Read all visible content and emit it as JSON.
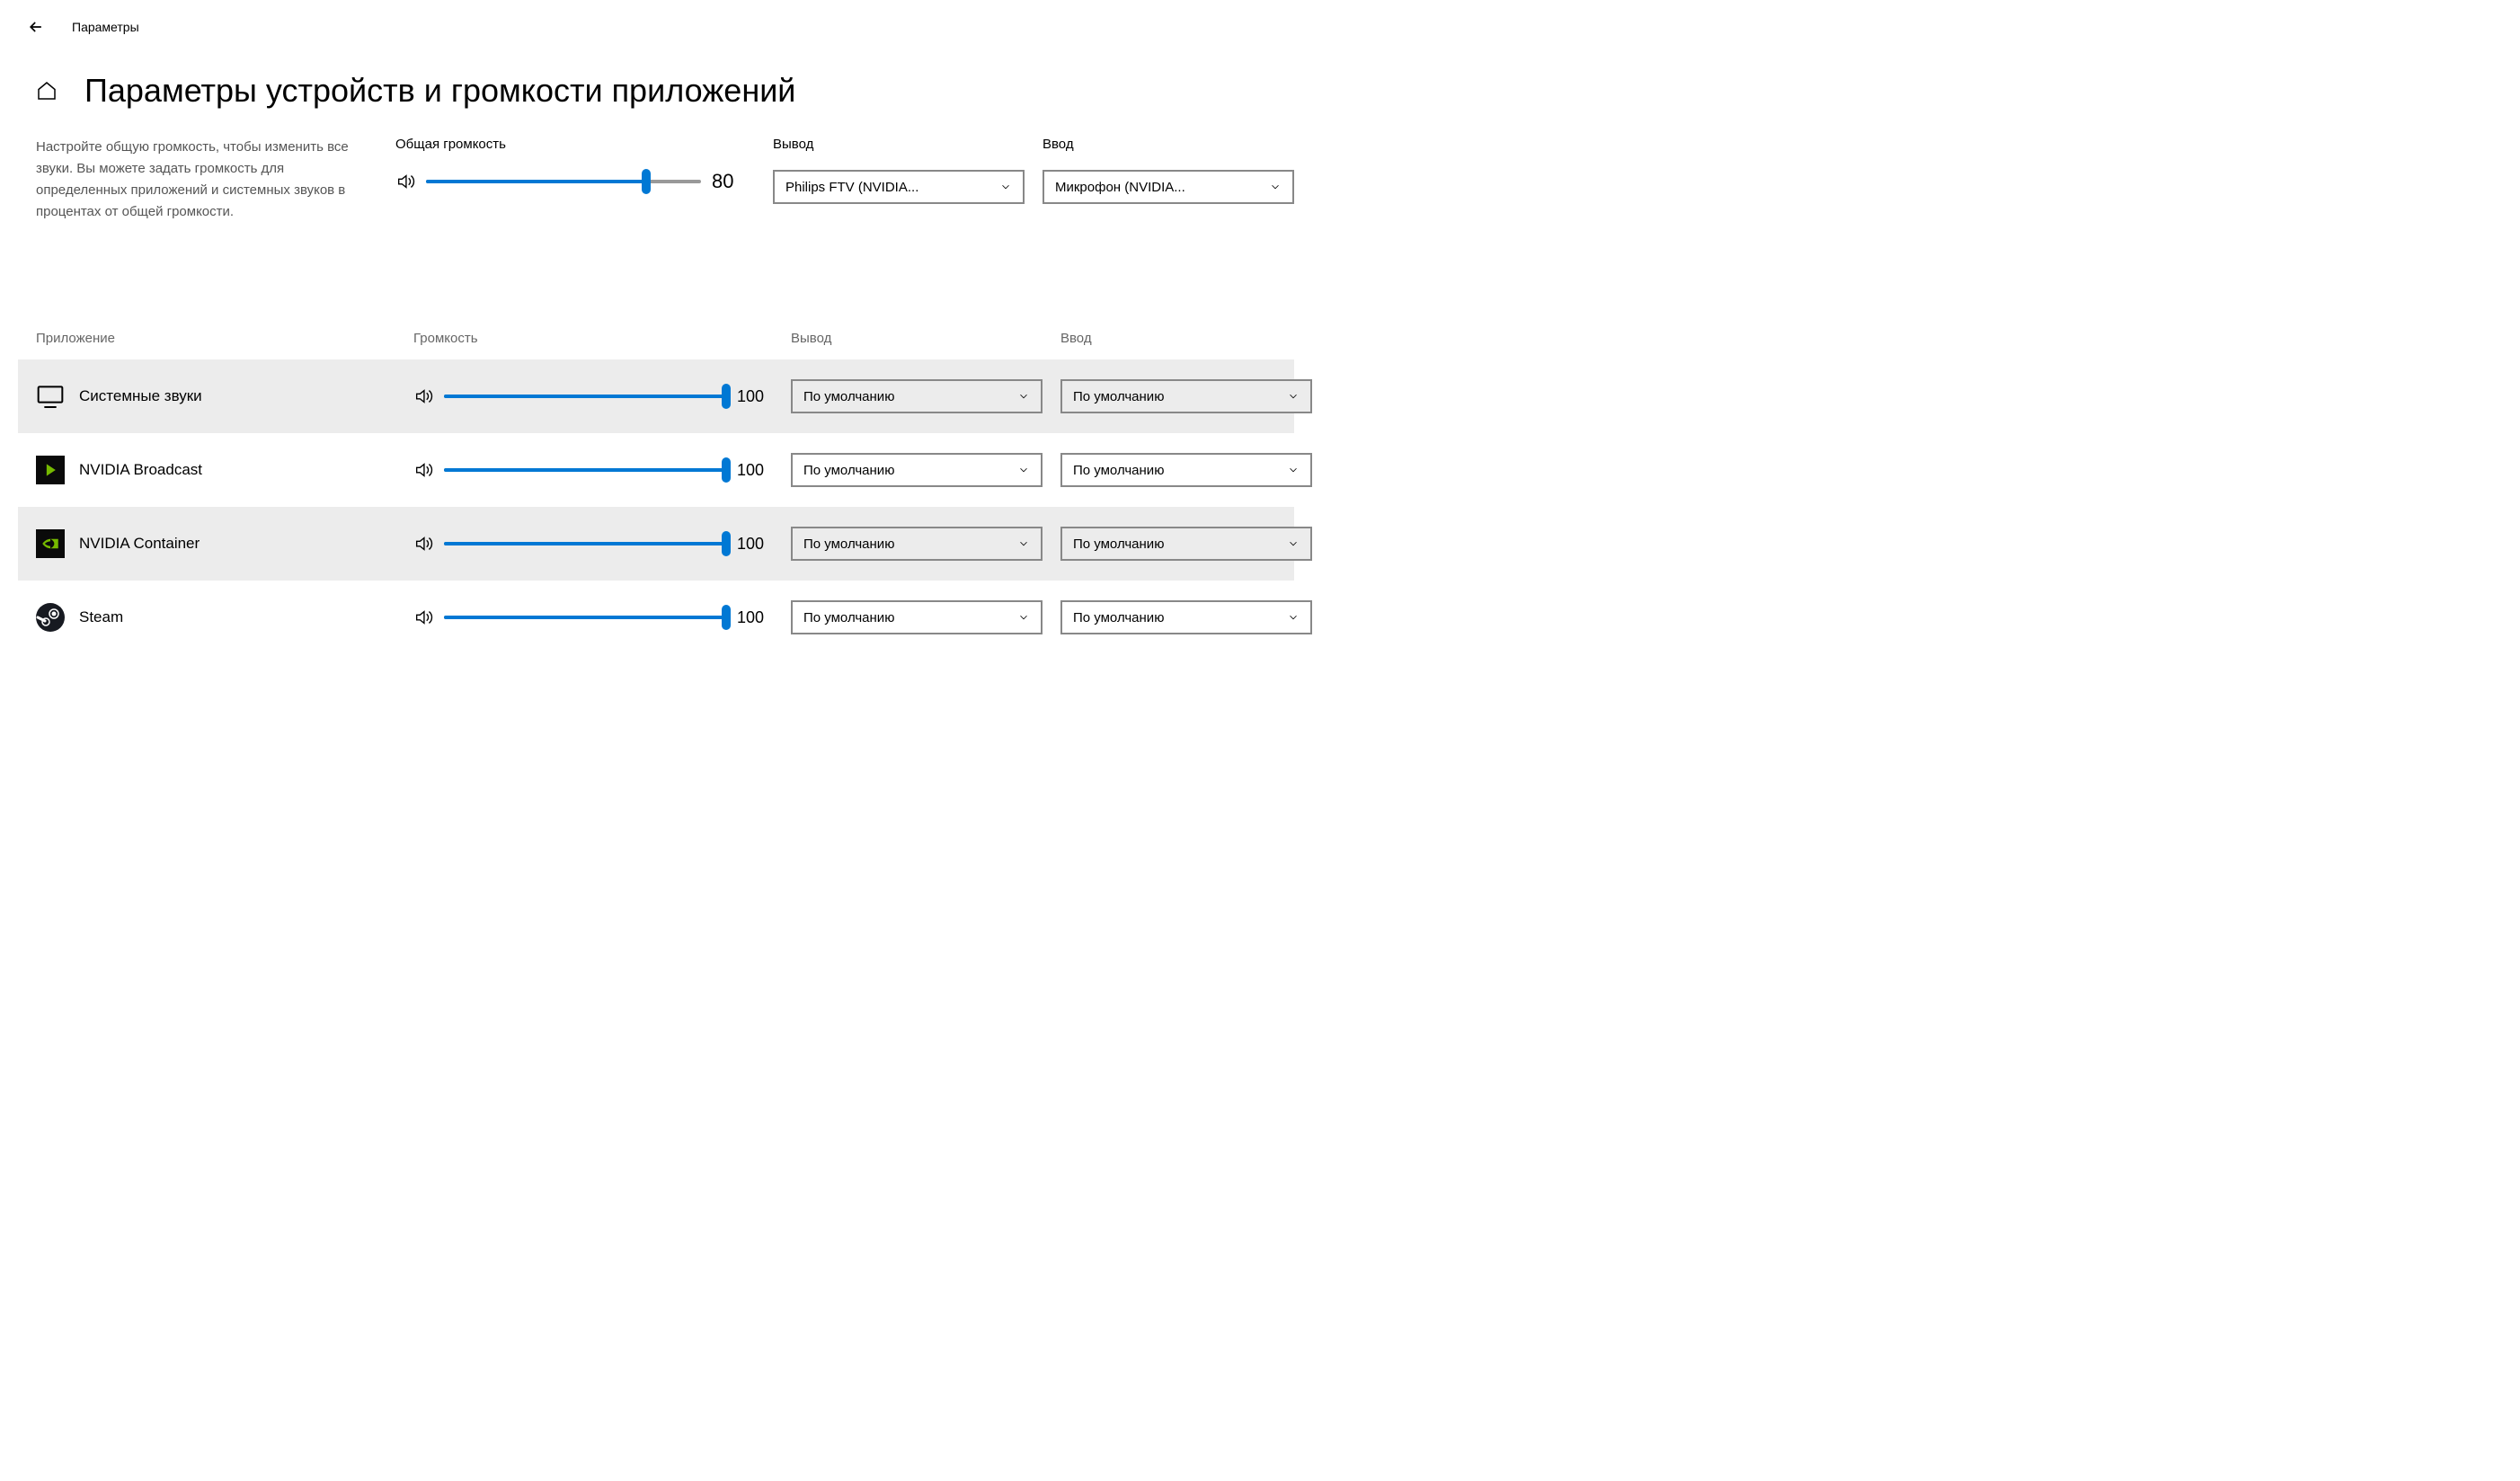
{
  "window": {
    "title": "Параметры"
  },
  "page": {
    "title": "Параметры устройств и громкости приложений",
    "description": "Настройте общую громкость, чтобы изменить все звуки. Вы можете задать громкость для определенных приложений и системных звуков в процентах от общей громкости."
  },
  "master": {
    "volume_label": "Общая громкость",
    "volume": 80,
    "output_label": "Вывод",
    "output_value": "Philips FTV (NVIDIA...",
    "input_label": "Ввод",
    "input_value": "Микрофон (NVIDIA..."
  },
  "columns": {
    "app": "Приложение",
    "volume": "Громкость",
    "output": "Вывод",
    "input": "Ввод"
  },
  "default_text": "По умолчанию",
  "apps": [
    {
      "name": "Системные звуки",
      "volume": 100,
      "output": "По умолчанию",
      "input": "По умолчанию",
      "icon": "monitor",
      "alt": true
    },
    {
      "name": "NVIDIA Broadcast",
      "volume": 100,
      "output": "По умолчанию",
      "input": "По умолчанию",
      "icon": "nvidia-broadcast",
      "alt": false
    },
    {
      "name": "NVIDIA Container",
      "volume": 100,
      "output": "По умолчанию",
      "input": "По умолчанию",
      "icon": "nvidia",
      "alt": true
    },
    {
      "name": "Steam",
      "volume": 100,
      "output": "По умолчанию",
      "input": "По умолчанию",
      "icon": "steam",
      "alt": false
    }
  ]
}
